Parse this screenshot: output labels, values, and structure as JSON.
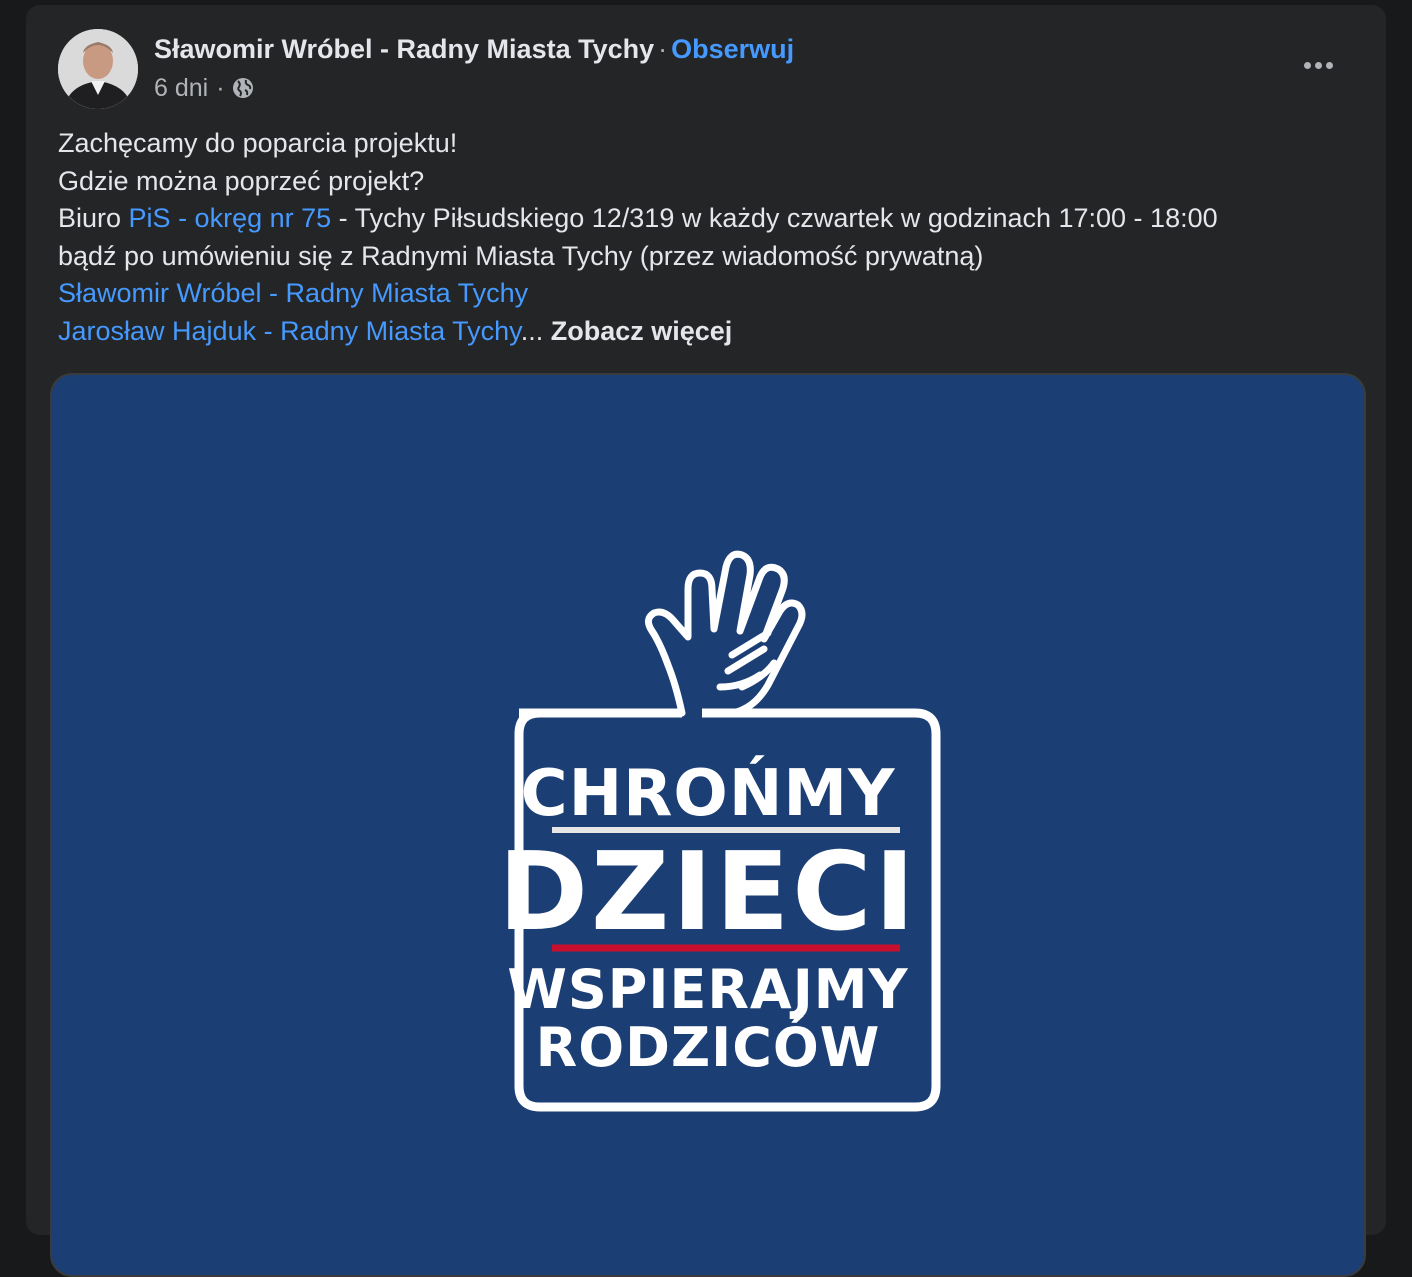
{
  "post": {
    "author_name": "Sławomir Wróbel - Radny Miasta Tychy",
    "separator": "·",
    "follow_label": "Obserwuj",
    "time": "6 dni",
    "meta_separator": "·",
    "privacy_icon": "globe-icon",
    "more_icon": "more-options-icon",
    "text": {
      "line1": "Zachęcamy do poparcia projektu!",
      "line2": "Gdzie można poprzeć projekt?",
      "line3_prefix": "Biuro ",
      "line3_link": "PiS - okręg nr 75",
      "line3_suffix": " - Tychy Piłsudskiego 12/319 w każdy czwartek w godzinach 17:00 - 18:00",
      "line4": "bądź po umówieniu się z Radnymi Miasta Tychy (przez wiadomość prywatną)",
      "mention1": "Sławomir Wróbel - Radny Miasta Tychy",
      "mention2": "Jarosław Hajduk - Radny Miasta Tychy",
      "ellipsis": "...",
      "see_more": "Zobacz więcej"
    }
  },
  "image": {
    "line1": "CHROŃMY",
    "line2": "DZIECI",
    "line3": "WSPIERAJMY",
    "line4": "RODZICÓW",
    "background_color": "#1b3e74",
    "accent_color": "#c8102e",
    "icon": "hands-icon"
  },
  "colors": {
    "background": "#18191a",
    "card": "#242526",
    "link": "#4599ff",
    "text": "#e4e6eb",
    "secondary_text": "#b0b3b8"
  }
}
